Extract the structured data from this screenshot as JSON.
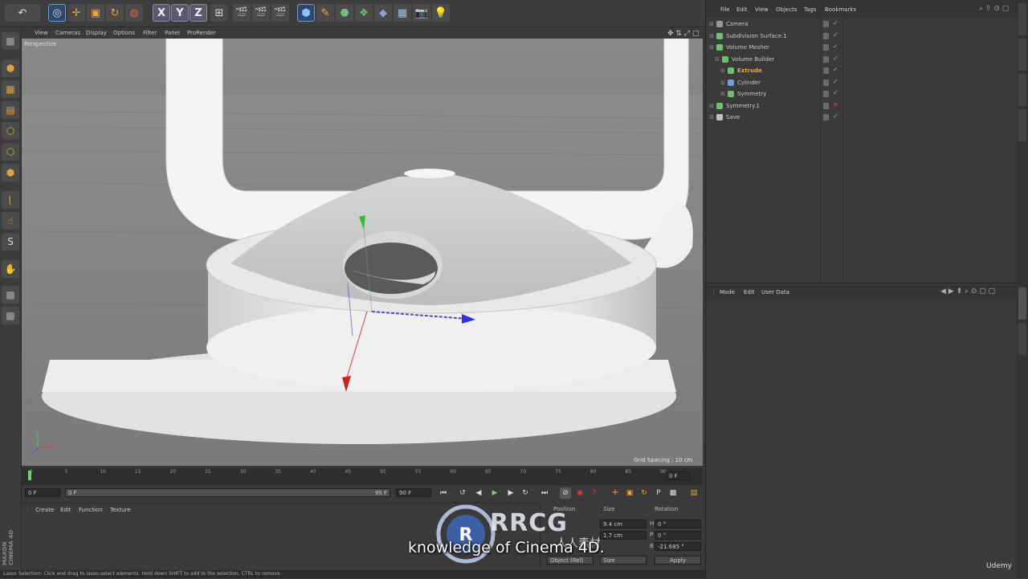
{
  "viewport": {
    "menu": [
      "View",
      "Cameras",
      "Display",
      "Options",
      "Filter",
      "Panel",
      "ProRender"
    ],
    "label": "Perspective",
    "grid_spacing": "Grid Spacing : 10 cm"
  },
  "timeline": {
    "ticks": [
      "0",
      "5",
      "10",
      "15",
      "20",
      "25",
      "30",
      "35",
      "40",
      "45",
      "50",
      "55",
      "60",
      "65",
      "70",
      "75",
      "80",
      "85",
      "90"
    ],
    "current_frame": "0 F",
    "range_start": "0 F",
    "range_end": "90 F",
    "end_frame": "90 F",
    "frame_indicator": "0 F"
  },
  "material_manager": {
    "menu": [
      "Create",
      "Edit",
      "Function",
      "Texture"
    ]
  },
  "coordinates": {
    "headers": [
      "Position",
      "Size",
      "Rotation"
    ],
    "size_x": "9.4 cm",
    "size_y": "1.7 cm",
    "rot_h": "0 °",
    "rot_p": "0 °",
    "rot_b": "-21.685 °",
    "axis_h": "H",
    "axis_p": "P",
    "axis_b": "B",
    "mode_object": "Object (Rel)",
    "mode_size": "Size",
    "apply": "Apply"
  },
  "status_bar": "Lasso Selection: Click and drag to lasso-select elements. Hold down SHIFT to add to the selection, CTRL to remove.",
  "object_manager": {
    "menu": [
      "File",
      "Edit",
      "View",
      "Objects",
      "Tags",
      "Bookmarks"
    ],
    "objects": [
      {
        "name": "Camera",
        "icon_color": "#9a9a9a",
        "indent": 0,
        "selected": false
      },
      {
        "name": "Subdivision Surface.1",
        "icon_color": "#6fc06f",
        "indent": 0,
        "selected": false
      },
      {
        "name": "Volume Mesher",
        "icon_color": "#6fc06f",
        "indent": 0,
        "selected": false
      },
      {
        "name": "Volume Builder",
        "icon_color": "#6fc06f",
        "indent": 1,
        "selected": false
      },
      {
        "name": "Extrude",
        "icon_color": "#6fc06f",
        "indent": 2,
        "selected": true
      },
      {
        "name": "Cylinder",
        "icon_color": "#6f9fe0",
        "indent": 2,
        "selected": false
      },
      {
        "name": "Symmetry",
        "icon_color": "#6fc06f",
        "indent": 2,
        "selected": false
      },
      {
        "name": "Symmetry.1",
        "icon_color": "#6fc06f",
        "indent": 0,
        "selected": false
      },
      {
        "name": "Save",
        "icon_color": "#c0c0c0",
        "indent": 0,
        "selected": false
      }
    ]
  },
  "attributes": {
    "menu": [
      "Mode",
      "Edit",
      "User Data"
    ]
  },
  "overlay": {
    "subtitle": "knowledge of Cinema 4D.",
    "watermark": "RRCG",
    "watermark_cn": "人人素材",
    "udemy": "Udemy"
  },
  "colors": {
    "accent_orange": "#f3a640",
    "selection_blue": "#2d4a6e",
    "panel_bg": "#3a3a3a"
  }
}
